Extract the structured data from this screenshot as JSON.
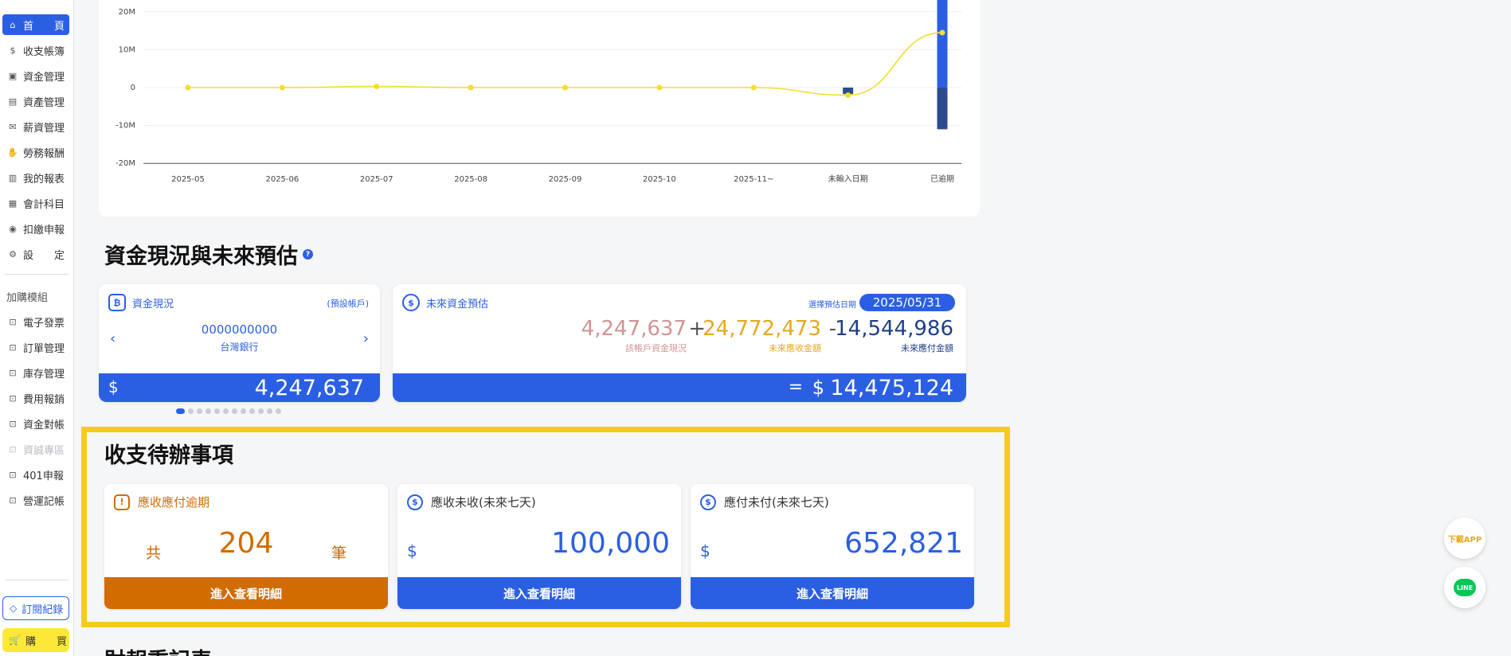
{
  "sidebar": {
    "items": [
      {
        "label": "首　　頁",
        "icon": "home-icon"
      },
      {
        "label": "收支帳簿",
        "icon": "coin-icon"
      },
      {
        "label": "資金管理",
        "icon": "money-icon"
      },
      {
        "label": "資產管理",
        "icon": "asset-icon"
      },
      {
        "label": "薪資管理",
        "icon": "salary-icon"
      },
      {
        "label": "勞務報酬",
        "icon": "handshake-icon"
      },
      {
        "label": "我的報表",
        "icon": "report-icon"
      },
      {
        "label": "會計科目",
        "icon": "ledger-icon"
      },
      {
        "label": "扣繳申報",
        "icon": "withholding-icon"
      },
      {
        "label": "設　　定",
        "icon": "settings-icon"
      }
    ],
    "addon_title": "加購模組",
    "addons": [
      {
        "label": "電子發票"
      },
      {
        "label": "訂單管理"
      },
      {
        "label": "庫存管理"
      },
      {
        "label": "費用報銷"
      },
      {
        "label": "資金對帳"
      },
      {
        "label": "資誠專區"
      },
      {
        "label": "401申報"
      },
      {
        "label": "營運記帳"
      }
    ],
    "subscription_label": "訂閱紀錄",
    "buy_label": "購　　買"
  },
  "chart_data": {
    "type": "bar",
    "categories": [
      "2025-05",
      "2025-06",
      "2025-07",
      "2025-08",
      "2025-09",
      "2025-10",
      "2025-11~",
      "未輸入日期",
      "已逾期"
    ],
    "y_ticks": [
      "20M",
      "10M",
      "0",
      "-10M",
      "-20M"
    ],
    "ylim": [
      -20,
      20
    ],
    "series": [
      {
        "kind": "bar-positive",
        "color": "#2b5fe3",
        "values": [
          0,
          0,
          0,
          0,
          0,
          0,
          0,
          0,
          25
        ]
      },
      {
        "kind": "bar-negative",
        "color": "#2c4b8f",
        "values": [
          0,
          0,
          0,
          0,
          0,
          0,
          0,
          -1.7,
          -11
        ]
      },
      {
        "kind": "line",
        "color": "#f4dd33",
        "values": [
          0,
          0,
          0.3,
          0,
          0,
          0,
          0,
          -2,
          14.5
        ]
      }
    ]
  },
  "funds": {
    "title": "資金現況與未來預估",
    "current": {
      "title": "資金現況",
      "tag": "(預設帳戶)",
      "account": "0000000000",
      "bank": "台灣銀行",
      "currency": "$",
      "amount": "4,247,637"
    },
    "forecast": {
      "title": "未來資金預估",
      "date_label": "選擇預估日期",
      "date": "2025/05/31",
      "a_value": "4,247,637",
      "a_label": "該帳戶資金現況",
      "plus": "+",
      "b_value": "24,772,473",
      "b_label": "未來應收金額",
      "minus": "-",
      "c_value": "14,544,986",
      "c_label": "未來應付金額",
      "equals": "=",
      "currency": "$",
      "result": "14,475,124"
    }
  },
  "todo": {
    "title": "收支待辦事項",
    "overdue": {
      "title": "應收應付逾期",
      "prefix": "共",
      "count": "204",
      "suffix": "筆",
      "button": "進入查看明細"
    },
    "receivable": {
      "title": "應收未收(未來七天)",
      "currency": "$",
      "amount": "100,000",
      "button": "進入查看明細"
    },
    "payable": {
      "title": "應付未付(未來七天)",
      "currency": "$",
      "amount": "652,821",
      "button": "進入查看明細"
    }
  },
  "next_section_title": "財報重記表",
  "floating": {
    "download_app": "下載APP",
    "line": "LINE"
  }
}
